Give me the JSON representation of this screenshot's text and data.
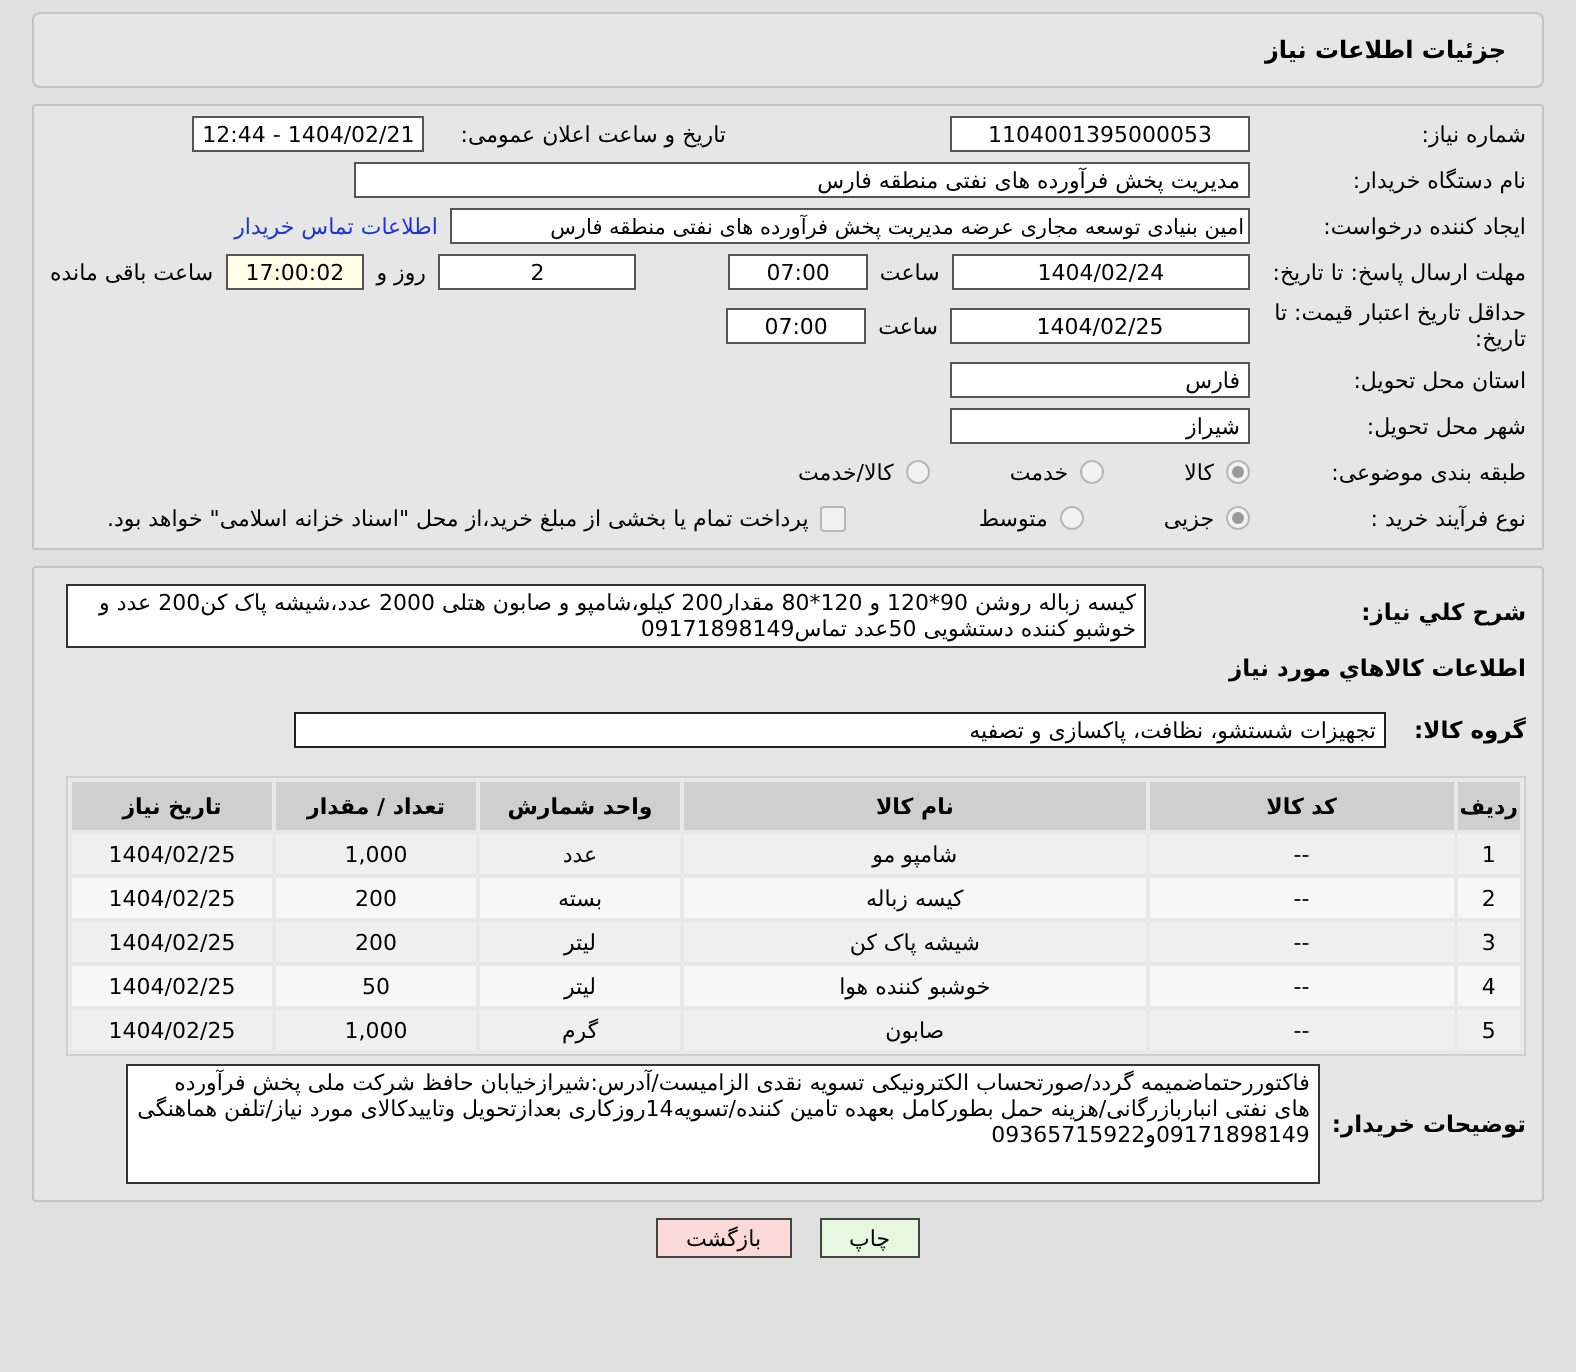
{
  "title": "جزئیات اطلاعات نیاز",
  "need_number": {
    "label": "شماره نیاز:",
    "value": "1104001395000053"
  },
  "announce": {
    "label": "تاریخ و ساعت اعلان عمومی:",
    "value": "1404/02/21 - 12:44"
  },
  "buyer_org": {
    "label": "نام دستگاه خریدار:",
    "value": "مدیریت پخش فرآورده های نفتی منطقه فارس"
  },
  "requester": {
    "label": "ایجاد کننده درخواست:",
    "value": "امین بنیادی توسعه مجاری عرضه مدیریت پخش فرآورده های نفتی منطقه فارس",
    "link": "اطلاعات تماس خریدار"
  },
  "reply_deadline": {
    "label": "مهلت ارسال پاسخ: تا تاریخ:",
    "date": "1404/02/24",
    "time_label": "ساعت",
    "time": "07:00",
    "days": "2",
    "days_label": "روز و",
    "remaining": "17:00:02",
    "remaining_label": "ساعت باقی مانده"
  },
  "price_validity": {
    "label": "حداقل تاریخ اعتبار قیمت: تا تاریخ:",
    "date": "1404/02/25",
    "time_label": "ساعت",
    "time": "07:00"
  },
  "province": {
    "label": "استان محل تحویل:",
    "value": "فارس"
  },
  "city": {
    "label": "شهر محل تحویل:",
    "value": "شیراز"
  },
  "category": {
    "label": "طبقه بندی موضوعی:",
    "options": [
      {
        "label": "کالا",
        "selected": true
      },
      {
        "label": "خدمت",
        "selected": false
      },
      {
        "label": "کالا/خدمت",
        "selected": false
      }
    ]
  },
  "process": {
    "label": "نوع فرآیند خرید :",
    "options": [
      {
        "label": "جزیی",
        "selected": true
      },
      {
        "label": "متوسط",
        "selected": false
      }
    ],
    "payment": {
      "label": "پرداخت تمام یا بخشی از مبلغ خرید،از محل \"اسناد خزانه اسلامی\" خواهد بود.",
      "checked": false
    }
  },
  "description": {
    "label": "شرح کلي نياز:",
    "value": "کیسه زباله روشن 90*120 و 120*80 مقدار200 کیلو،شامپو و صابون هتلی 2000 عدد،شیشه پاک کن200 عدد و خوشبو کننده دستشویی 50عدد تماس09171898149"
  },
  "goods_title": "اطلاعات کالاهاي مورد نياز",
  "goods_group": {
    "label": "گروه کالا:",
    "value": "تجهیزات شستشو، نظافت، پاکسازی و تصفیه"
  },
  "table": {
    "columns": [
      "ردیف",
      "کد کالا",
      "نام کالا",
      "واحد شمارش",
      "تعداد / مقدار",
      "تاریخ نیاز"
    ],
    "rows": [
      [
        "1",
        "--",
        "شامپو مو",
        "عدد",
        "1,000",
        "1404/02/25"
      ],
      [
        "2",
        "--",
        "کیسه زباله",
        "بسته",
        "200",
        "1404/02/25"
      ],
      [
        "3",
        "--",
        "شیشه پاک کن",
        "لیتر",
        "200",
        "1404/02/25"
      ],
      [
        "4",
        "--",
        "خوشبو کننده هوا",
        "لیتر",
        "50",
        "1404/02/25"
      ],
      [
        "5",
        "--",
        "صابون",
        "گرم",
        "1,000",
        "1404/02/25"
      ]
    ]
  },
  "buyer_notes": {
    "label": "توضیحات خریدار:",
    "value": "فاکتوررحتماضمیمه گردد/صورتحساب الکترونیکی تسویه نقدی الزامیست/آدرس:شیرازخیابان حافظ شرکت ملی پخش فرآورده های نفتی انباربازرگانی/هزینه حمل بطورکامل بعهده تامین کننده/تسویه14روزکاری بعدازتحویل وتاییدکالای مورد نیاز/تلفن هماهنگی 09171898149و09365715922"
  },
  "buttons": [
    {
      "label": "چاپ",
      "kind": "print"
    },
    {
      "label": "بازگشت",
      "kind": "back"
    }
  ]
}
